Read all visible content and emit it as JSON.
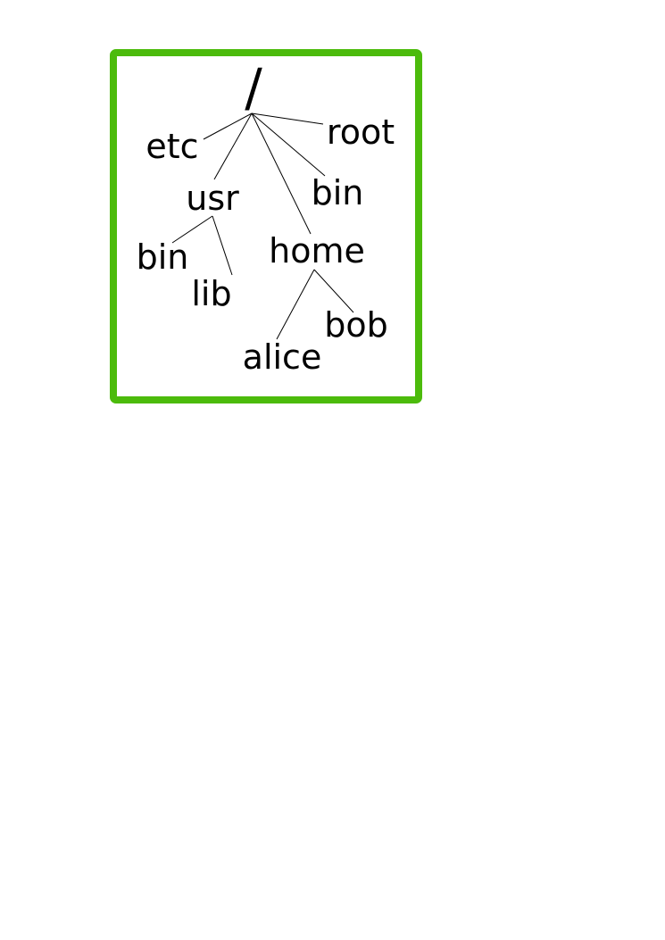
{
  "diagram": {
    "type": "directory-tree",
    "frame_color": "#4cbb0c",
    "line_color": "#000000",
    "text_color": "#000000",
    "nodes": {
      "root_dir": "/",
      "etc": "etc",
      "usr": "usr",
      "usr_bin": "bin",
      "usr_lib": "lib",
      "home": "home",
      "alice": "alice",
      "bob": "bob",
      "bin": "bin",
      "root": "root"
    },
    "edges": [
      [
        "root_dir",
        "etc"
      ],
      [
        "root_dir",
        "usr"
      ],
      [
        "root_dir",
        "home"
      ],
      [
        "root_dir",
        "bin"
      ],
      [
        "root_dir",
        "root"
      ],
      [
        "usr",
        "usr_bin"
      ],
      [
        "usr",
        "usr_lib"
      ],
      [
        "home",
        "alice"
      ],
      [
        "home",
        "bob"
      ]
    ]
  }
}
